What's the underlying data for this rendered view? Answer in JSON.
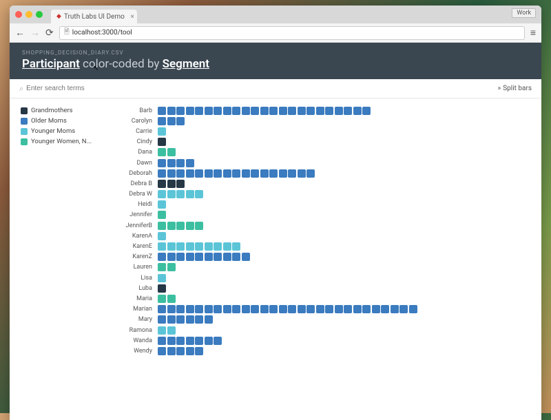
{
  "browser": {
    "tab_title": "Truth Labs UI Demo",
    "work_label": "Work",
    "url": "localhost:3000/tool"
  },
  "header": {
    "filename": "SHOPPING_DECISION_DIARY.CSV",
    "title_entity": "Participant",
    "title_mid": " color-coded by ",
    "title_group": "Segment"
  },
  "search": {
    "placeholder": "Enter search terms",
    "split_label": "Split bars"
  },
  "colors": {
    "grandmothers": "#263746",
    "older_moms": "#3b7bbf",
    "younger_moms": "#5bc5d7",
    "younger_women": "#3cbfa0"
  },
  "legend": [
    {
      "label": "Grandmothers",
      "color_key": "grandmothers"
    },
    {
      "label": "Older Moms",
      "color_key": "older_moms"
    },
    {
      "label": "Younger Moms",
      "color_key": "younger_moms"
    },
    {
      "label": "Younger Women, N...",
      "color_key": "younger_women"
    }
  ],
  "chart_data": {
    "type": "bar",
    "title": "Participant color-coded by Segment",
    "ylabel": "Participant",
    "xlabel": "",
    "categories": [
      "Barb",
      "Carolyn",
      "Carrie",
      "Cindy",
      "Dana",
      "Dawn",
      "Deborah",
      "Debra B",
      "Debra W",
      "Heidi",
      "Jennifer",
      "JenniferB",
      "KarenA",
      "KarenE",
      "KarenZ",
      "Lauren",
      "Lisa",
      "Luba",
      "Maria",
      "Marian",
      "Mary",
      "Ramona",
      "Wanda",
      "Wendy"
    ],
    "stack_colors": {
      "g": "grandmothers",
      "o": "older_moms",
      "y": "younger_moms",
      "w": "younger_women"
    },
    "series_by_row": [
      {
        "name": "Barb",
        "blocks": [
          "o",
          "o",
          "o",
          "o",
          "o",
          "o",
          "o",
          "o",
          "o",
          "o",
          "o",
          "o",
          "o",
          "o",
          "o",
          "o",
          "o",
          "o",
          "o",
          "o",
          "o",
          "o",
          "o"
        ]
      },
      {
        "name": "Carolyn",
        "blocks": [
          "o",
          "o",
          "o"
        ]
      },
      {
        "name": "Carrie",
        "blocks": [
          "y"
        ]
      },
      {
        "name": "Cindy",
        "blocks": [
          "g"
        ]
      },
      {
        "name": "Dana",
        "blocks": [
          "w",
          "w"
        ]
      },
      {
        "name": "Dawn",
        "blocks": [
          "o",
          "o",
          "o",
          "o"
        ]
      },
      {
        "name": "Deborah",
        "blocks": [
          "o",
          "o",
          "o",
          "o",
          "o",
          "o",
          "o",
          "o",
          "o",
          "o",
          "o",
          "o",
          "o",
          "o",
          "o",
          "o",
          "o"
        ]
      },
      {
        "name": "Debra B",
        "blocks": [
          "g",
          "g",
          "g"
        ]
      },
      {
        "name": "Debra W",
        "blocks": [
          "y",
          "y",
          "y",
          "y",
          "y"
        ]
      },
      {
        "name": "Heidi",
        "blocks": [
          "y"
        ]
      },
      {
        "name": "Jennifer",
        "blocks": [
          "w"
        ]
      },
      {
        "name": "JenniferB",
        "blocks": [
          "w",
          "w",
          "w",
          "w",
          "w"
        ]
      },
      {
        "name": "KarenA",
        "blocks": [
          "y"
        ]
      },
      {
        "name": "KarenE",
        "blocks": [
          "y",
          "y",
          "y",
          "y",
          "y",
          "y",
          "y",
          "y",
          "y"
        ]
      },
      {
        "name": "KarenZ",
        "blocks": [
          "o",
          "o",
          "o",
          "o",
          "o",
          "o",
          "o",
          "o",
          "o",
          "o"
        ]
      },
      {
        "name": "Lauren",
        "blocks": [
          "w",
          "w"
        ]
      },
      {
        "name": "Lisa",
        "blocks": [
          "y"
        ]
      },
      {
        "name": "Luba",
        "blocks": [
          "g"
        ]
      },
      {
        "name": "Maria",
        "blocks": [
          "w",
          "w"
        ]
      },
      {
        "name": "Marian",
        "blocks": [
          "o",
          "o",
          "o",
          "o",
          "o",
          "o",
          "o",
          "o",
          "o",
          "o",
          "o",
          "o",
          "o",
          "o",
          "o",
          "o",
          "o",
          "o",
          "o",
          "o",
          "o",
          "o",
          "o",
          "o",
          "o",
          "o",
          "o",
          "o"
        ]
      },
      {
        "name": "Mary",
        "blocks": [
          "o",
          "o",
          "o",
          "o",
          "o",
          "o"
        ]
      },
      {
        "name": "Ramona",
        "blocks": [
          "y",
          "y"
        ]
      },
      {
        "name": "Wanda",
        "blocks": [
          "o",
          "o",
          "o",
          "o",
          "o",
          "o",
          "o"
        ]
      },
      {
        "name": "Wendy",
        "blocks": [
          "o",
          "o",
          "o",
          "o",
          "o"
        ]
      }
    ]
  }
}
